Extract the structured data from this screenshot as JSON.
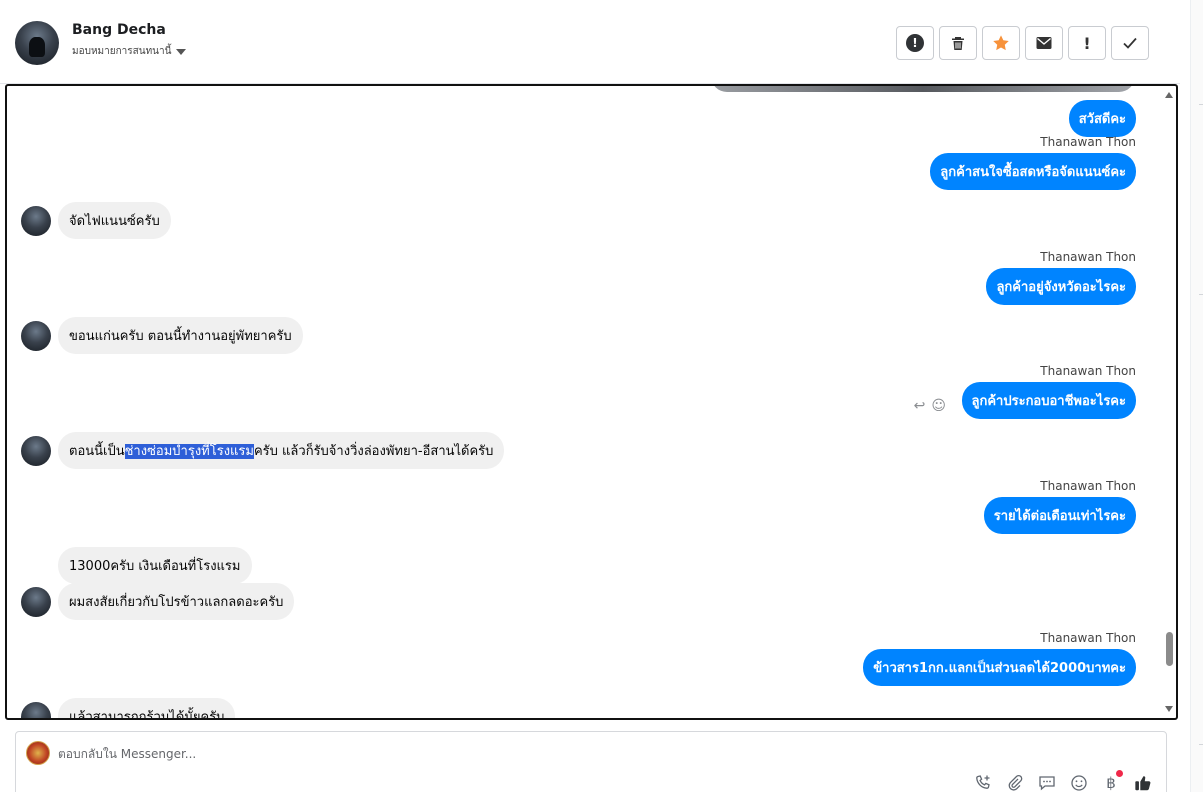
{
  "header": {
    "contact_name": "Bang Decha",
    "assign_label": "มอบหมายการสนทนานี้",
    "toolbar": [
      {
        "name": "spam-button",
        "icon": "alert-circle-icon",
        "glyph": "!"
      },
      {
        "name": "delete-button",
        "icon": "trash-icon",
        "glyph": "🗑"
      },
      {
        "name": "star-button",
        "icon": "star-icon",
        "glyph": "★"
      },
      {
        "name": "mark-unread-button",
        "icon": "envelope-icon",
        "glyph": "✉"
      },
      {
        "name": "follow-up-button",
        "icon": "exclamation-icon",
        "glyph": "!"
      },
      {
        "name": "mark-done-button",
        "icon": "check-icon",
        "glyph": "✓"
      }
    ]
  },
  "thread": {
    "messages": [
      {
        "dir": "out",
        "sender": "",
        "text": "สวัสดีคะ"
      },
      {
        "dir": "out",
        "sender": "Thanawan Thon",
        "text": "ลูกค้าสนใจซื้อสดหรือจัดแนนซ์คะ"
      },
      {
        "dir": "in",
        "text": "จัดไฟแนนซ์ครับ"
      },
      {
        "dir": "out",
        "sender": "Thanawan Thon",
        "text": "ลูกค้าอยู่จังหวัดอะไรคะ"
      },
      {
        "dir": "in",
        "text": "ขอนแก่นครับ ตอนนี้ทำงานอยู่พัทยาครับ"
      },
      {
        "dir": "out",
        "sender": "Thanawan Thon",
        "text": "ลูกค้าประกอบอาชีพอะไรคะ"
      },
      {
        "dir": "in",
        "text_before": "ตอนนี้เป็น",
        "text_highlight": "ช่างซ่อมบำรุงที่โรงแรม",
        "text_after": "ครับ แล้วก็รับจ้างวิ่งล่องพัทยา-อีสานได้ครับ"
      },
      {
        "dir": "out",
        "sender": "Thanawan Thon",
        "text": "รายได้ต่อเดือนเท่าไรคะ"
      },
      {
        "dir": "in",
        "text": "13000ครับ เงินเดือนที่โรงแรม"
      },
      {
        "dir": "in",
        "text": "ผมสงสัยเกี่ยวกับโปรข้าวแลกลดอะครับ"
      },
      {
        "dir": "out",
        "sender": "Thanawan Thon",
        "text": "ข้าวสาร1กก.แลกเป็นส่วนลดได้2000บาทคะ"
      },
      {
        "dir": "in",
        "text": "แล้วสามารถกร้วมได้มั้ยครับ"
      }
    ],
    "reaction_icons": [
      "reply-icon",
      "emoji-icon"
    ]
  },
  "composer": {
    "placeholder": "ตอบกลับใน Messenger...",
    "icons": [
      "call-add-icon",
      "attachment-icon",
      "saved-reply-icon",
      "emoji-icon",
      "payment-icon",
      "like-icon"
    ]
  },
  "colors": {
    "outgoing_bubble": "#0084ff",
    "incoming_bubble": "#f0f0f0",
    "selection_highlight": "#2e5fd8",
    "star_accent": "#f7923b"
  }
}
